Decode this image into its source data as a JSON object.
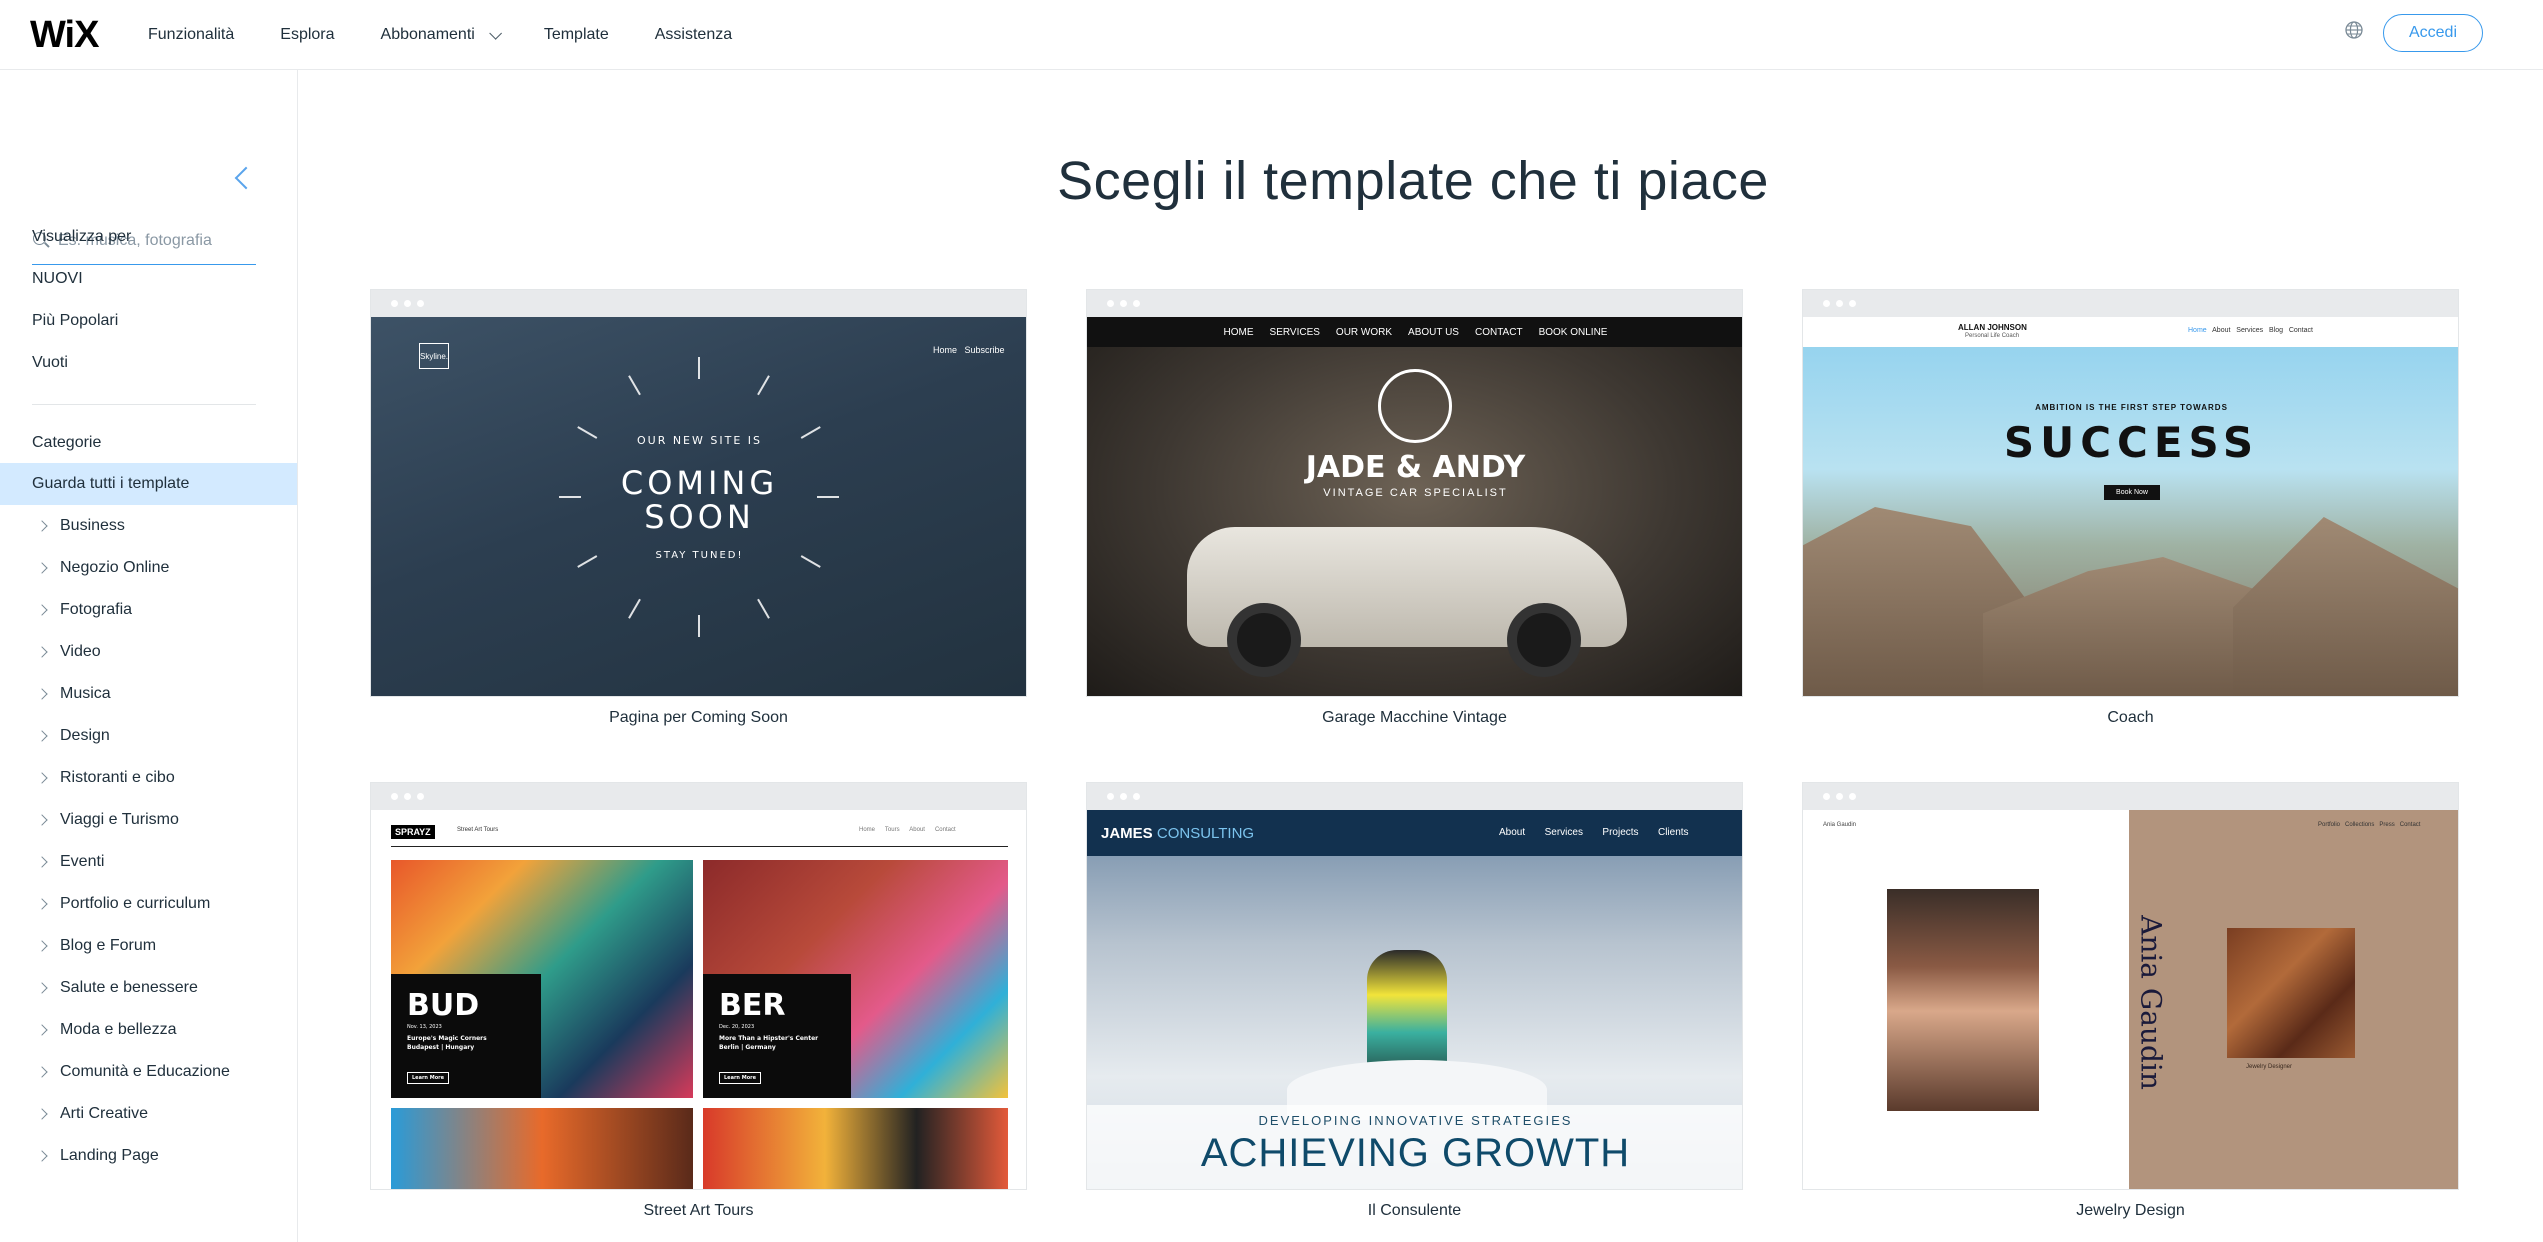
{
  "header": {
    "logo": "WiX",
    "nav": [
      {
        "label": "Funzionalità"
      },
      {
        "label": "Esplora"
      },
      {
        "label": "Abbonamenti",
        "has_dropdown": true
      },
      {
        "label": "Template"
      },
      {
        "label": "Assistenza"
      }
    ],
    "language_icon": "globe-icon",
    "login_label": "Accedi"
  },
  "sidebar": {
    "search_placeholder": "Es. musica, fotografia",
    "view_by_label": "Visualizza per",
    "view_by": [
      {
        "label": "NUOVI"
      },
      {
        "label": "Più Popolari"
      },
      {
        "label": "Vuoti"
      }
    ],
    "categories_label": "Categorie",
    "active_category": "Guarda tutti i template",
    "categories": [
      {
        "label": "Business"
      },
      {
        "label": "Negozio Online"
      },
      {
        "label": "Fotografia"
      },
      {
        "label": "Video"
      },
      {
        "label": "Musica"
      },
      {
        "label": "Design"
      },
      {
        "label": "Ristoranti e cibo"
      },
      {
        "label": "Viaggi e Turismo"
      },
      {
        "label": "Eventi"
      },
      {
        "label": "Portfolio e curriculum"
      },
      {
        "label": "Blog e Forum"
      },
      {
        "label": "Salute e benessere"
      },
      {
        "label": "Moda e bellezza"
      },
      {
        "label": "Comunità e Educazione"
      },
      {
        "label": "Arti Creative"
      },
      {
        "label": "Landing Page"
      }
    ]
  },
  "main": {
    "title": "Scegli il template che ti piace",
    "templates": [
      {
        "label": "Pagina per Coming Soon",
        "thumb": {
          "logo": "Skyline.",
          "nav": [
            "Home",
            "Subscribe"
          ],
          "kicker": "OUR NEW SITE IS",
          "headline_1": "COMING",
          "headline_2": "SOON",
          "footer": "STAY TUNED!"
        }
      },
      {
        "label": "Garage Macchine Vintage",
        "thumb": {
          "nav": [
            "HOME",
            "SERVICES",
            "OUR WORK",
            "ABOUT US",
            "CONTACT",
            "BOOK ONLINE"
          ],
          "headline": "JADE & ANDY",
          "sub": "VINTAGE CAR SPECIALIST"
        }
      },
      {
        "label": "Coach",
        "thumb": {
          "brand": "ALLAN JOHNSON",
          "brand_sub": "Personal Life Coach",
          "nav": [
            "Home",
            "About",
            "Services",
            "Blog",
            "Contact"
          ],
          "kicker": "AMBITION IS THE FIRST STEP TOWARDS",
          "headline": "SUCCESS",
          "button": "Book Now"
        }
      },
      {
        "label": "Street Art Tours",
        "thumb": {
          "logo": "SPRAYZ",
          "logo_sub": "Street Art Tours",
          "nav": [
            "Home",
            "Tours",
            "About",
            "Contact"
          ],
          "city_1": "BUD",
          "city_1_date": "Nov. 13, 2023",
          "city_1_desc": "Europe's Magic Corners",
          "city_1_place": "Budapest | Hungary",
          "city_2": "BER",
          "city_2_date": "Dec. 20, 2023",
          "city_2_desc": "More Than a Hipster's Center",
          "city_2_place": "Berlin | Germany",
          "cta": "Learn More"
        }
      },
      {
        "label": "Il Consulente",
        "thumb": {
          "brand_a": "JAMES",
          "brand_b": "CONSULTING",
          "nav": [
            "About",
            "Services",
            "Projects",
            "Clients"
          ],
          "kicker": "DEVELOPING INNOVATIVE STRATEGIES",
          "headline": "ACHIEVING GROWTH"
        }
      },
      {
        "label": "Jewelry Design",
        "thumb": {
          "brand": "Ania Gaudin",
          "nav": [
            "Portfolio",
            "Collections",
            "Press",
            "Contact"
          ],
          "caption": "Jewelry Designer",
          "vertical_name": "Ania Gaudin"
        }
      }
    ]
  },
  "colors": {
    "accent": "#3899ec",
    "active_bg": "#d3eaff",
    "text": "#20303c"
  }
}
